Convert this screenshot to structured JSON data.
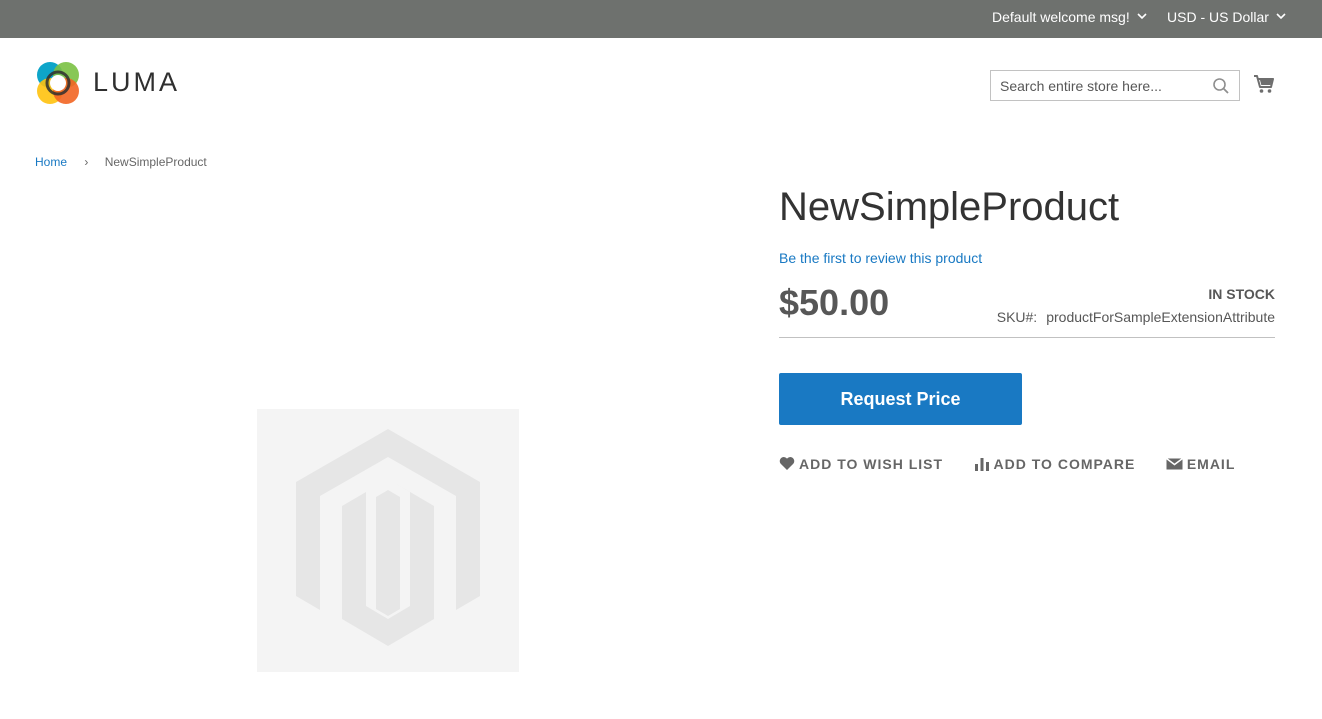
{
  "topbar": {
    "welcome": "Default welcome msg!",
    "currency": "USD - US Dollar"
  },
  "header": {
    "logo_text": "LUMA",
    "search_placeholder": "Search entire store here...",
    "icons": {
      "search": "search-icon",
      "cart": "cart-icon"
    }
  },
  "breadcrumb": {
    "home": "Home",
    "separator": "›",
    "current": "NewSimpleProduct"
  },
  "product": {
    "name": "NewSimpleProduct",
    "review_link": "Be the first to review this product",
    "price": "$50.00",
    "stock": "In stock",
    "sku_label": "SKU#:",
    "sku_value": "productForSampleExtensionAttribute",
    "request_price_label": "Request Price",
    "image_icon": "magento-placeholder-icon"
  },
  "actions": [
    {
      "label": "Add to Wish List",
      "icon": "heart-icon"
    },
    {
      "label": "Add to Compare",
      "icon": "compare-icon"
    },
    {
      "label": "Email",
      "icon": "envelope-icon"
    }
  ],
  "colors": {
    "topbar_bg": "#6e716e",
    "accent": "#1979c3",
    "text": "#333333",
    "placeholder_bg": "#f4f4f4"
  }
}
